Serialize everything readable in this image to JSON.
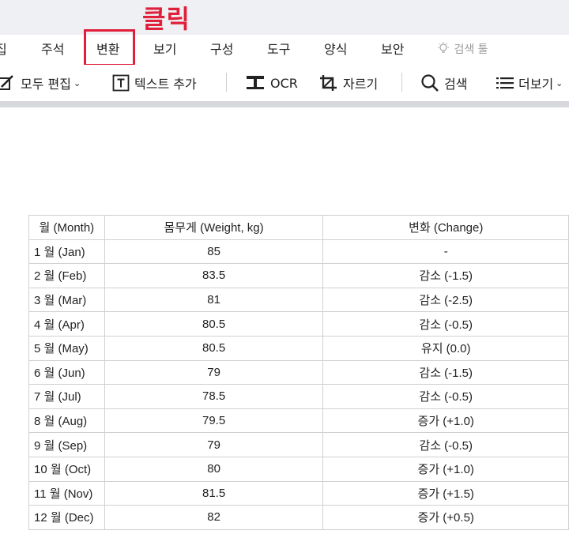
{
  "annotation": {
    "text": "클릭",
    "color": "#e0203a"
  },
  "menu": {
    "items": [
      {
        "label": "집",
        "name": "menu-edit-partial"
      },
      {
        "label": "주석",
        "name": "menu-annotate"
      },
      {
        "label": "변환",
        "name": "menu-convert"
      },
      {
        "label": "보기",
        "name": "menu-view"
      },
      {
        "label": "구성",
        "name": "menu-organize"
      },
      {
        "label": "도구",
        "name": "menu-tools"
      },
      {
        "label": "양식",
        "name": "menu-forms"
      },
      {
        "label": "보안",
        "name": "menu-security"
      }
    ],
    "search_tools_label": "검색 툴",
    "highlighted": "변환"
  },
  "toolbar": {
    "edit_all": "모두 편집",
    "add_text": "텍스트 추가",
    "ocr": "OCR",
    "crop": "자르기",
    "search": "검색",
    "more": "더보기"
  },
  "table": {
    "headers": [
      "월 (Month)",
      "몸무게 (Weight, kg)",
      "변화 (Change)"
    ],
    "rows": [
      [
        "1 월 (Jan)",
        "85",
        "-"
      ],
      [
        "2 월 (Feb)",
        "83.5",
        "감소 (-1.5)"
      ],
      [
        "3 월 (Mar)",
        "81",
        "감소 (-2.5)"
      ],
      [
        "4 월 (Apr)",
        "80.5",
        "감소 (-0.5)"
      ],
      [
        "5 월 (May)",
        "80.5",
        "유지 (0.0)"
      ],
      [
        "6 월 (Jun)",
        "79",
        "감소 (-1.5)"
      ],
      [
        "7 월 (Jul)",
        "78.5",
        "감소 (-0.5)"
      ],
      [
        "8 월 (Aug)",
        "79.5",
        "증가 (+1.0)"
      ],
      [
        "9 월 (Sep)",
        "79",
        "감소 (-0.5)"
      ],
      [
        "10 월 (Oct)",
        "80",
        "증가 (+1.0)"
      ],
      [
        "11 월 (Nov)",
        "81.5",
        "증가 (+1.5)"
      ],
      [
        "12 월 (Dec)",
        "82",
        "증가 (+0.5)"
      ]
    ]
  }
}
